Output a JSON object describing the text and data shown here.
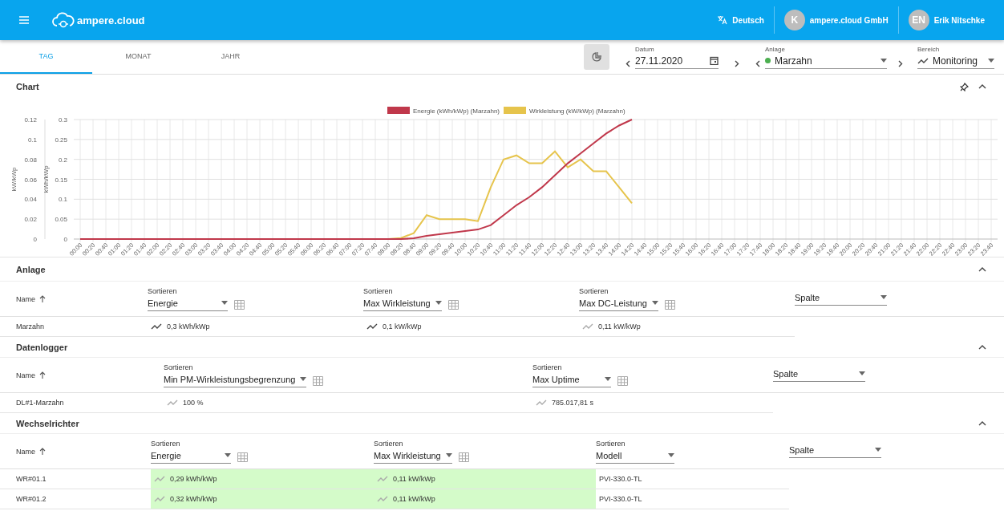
{
  "app_bar": {
    "brand": "ampere.cloud",
    "language": "Deutsch",
    "accounts": [
      {
        "initials": "K",
        "name": "ampere.cloud GmbH"
      },
      {
        "initials": "EN",
        "name": "Erik Nitschke"
      }
    ]
  },
  "tabs": [
    {
      "label": "TAG",
      "selected": true
    },
    {
      "label": "MONAT",
      "selected": false
    },
    {
      "label": "JAHR",
      "selected": false
    }
  ],
  "filters": {
    "date": {
      "label": "Datum",
      "value": "27.11.2020"
    },
    "plant": {
      "label": "Anlage",
      "value": "Marzahn",
      "color": "#4caf50"
    },
    "area": {
      "label": "Bereich",
      "value": "Monitoring"
    }
  },
  "chart": {
    "title": "Chart",
    "chart_data": {
      "type": "line",
      "grid": true,
      "legend": true,
      "ylabel": "kWh/kWp",
      "ylim": [
        0,
        0.3
      ],
      "yticks": [
        0,
        0.05,
        0.1,
        0.15,
        0.2,
        0.25,
        0.3
      ],
      "y2label": "kW/kWp",
      "y2lim": [
        0,
        0.12
      ],
      "y2ticks": [
        0,
        0.02,
        0.04,
        0.06,
        0.08,
        0.1,
        0.12
      ],
      "categories": [
        "00:00",
        "00:20",
        "00:40",
        "01:00",
        "01:20",
        "01:40",
        "02:00",
        "02:20",
        "02:40",
        "03:00",
        "03:20",
        "03:40",
        "04:00",
        "04:20",
        "04:40",
        "05:00",
        "05:20",
        "05:40",
        "06:00",
        "06:20",
        "06:40",
        "07:00",
        "07:20",
        "07:40",
        "08:00",
        "08:20",
        "08:40",
        "09:00",
        "09:20",
        "09:40",
        "10:00",
        "10:20",
        "10:40",
        "11:00",
        "11:20",
        "11:40",
        "12:00",
        "12:20",
        "12:40",
        "13:00",
        "13:20",
        "13:40",
        "14:00",
        "14:20",
        "14:40",
        "15:00",
        "15:20",
        "15:40",
        "16:00",
        "16:20",
        "16:40",
        "17:00",
        "17:20",
        "17:40",
        "18:00",
        "18:20",
        "18:40",
        "19:00",
        "19:20",
        "19:40",
        "20:00",
        "20:20",
        "20:40",
        "21:00",
        "21:20",
        "21:40",
        "22:00",
        "22:20",
        "22:40",
        "23:00",
        "23:20",
        "23:40"
      ],
      "series": [
        {
          "name": "Energie (kWh/kWp) (Marzahn)",
          "color": "#c0384b",
          "axis": "y",
          "values": [
            0,
            0,
            0,
            0,
            0,
            0,
            0,
            0,
            0,
            0,
            0,
            0,
            0,
            0,
            0,
            0,
            0,
            0,
            0,
            0,
            0,
            0,
            0,
            0,
            0,
            0,
            0.002,
            0.008,
            0.012,
            0.016,
            0.02,
            0.024,
            0.035,
            0.06,
            0.085,
            0.105,
            0.13,
            0.16,
            0.19,
            0.215,
            0.24,
            0.265,
            0.285,
            0.3,
            null,
            null,
            null,
            null,
            null,
            null,
            null,
            null,
            null,
            null,
            null,
            null,
            null,
            null,
            null,
            null,
            null,
            null,
            null,
            null,
            null,
            null,
            null,
            null,
            null,
            null,
            null,
            null
          ]
        },
        {
          "name": "Wirkleistung (kW/kWp) (Marzahn)",
          "color": "#e6c44c",
          "axis": "y2",
          "values": [
            null,
            null,
            null,
            null,
            null,
            null,
            null,
            null,
            null,
            null,
            null,
            null,
            null,
            null,
            null,
            null,
            null,
            null,
            null,
            null,
            null,
            null,
            null,
            null,
            0,
            0.001,
            0.006,
            0.024,
            0.02,
            0.02,
            0.02,
            0.018,
            0.052,
            0.08,
            0.084,
            0.076,
            0.076,
            0.088,
            0.072,
            0.08,
            0.068,
            0.068,
            0.052,
            0.036,
            null,
            null,
            null,
            null,
            null,
            null,
            null,
            null,
            null,
            null,
            null,
            null,
            null,
            null,
            null,
            null,
            null,
            null,
            null,
            null,
            null,
            null,
            null,
            null,
            null,
            null,
            null,
            null
          ]
        }
      ]
    }
  },
  "sections": [
    {
      "title": "Anlage",
      "name_header": "Name",
      "columns": [
        {
          "label": "Sortieren",
          "value": "Energie",
          "grid": true
        },
        {
          "label": "Sortieren",
          "value": "Max Wirkleistung",
          "grid": true
        },
        {
          "label": "Sortieren",
          "value": "Max DC-Leistung",
          "grid": true
        },
        {
          "value": "Spalte",
          "grid": false
        }
      ],
      "rows": [
        {
          "name": "Marzahn",
          "cells": [
            {
              "text": "0,3 kWh/kWp",
              "kind": "trend",
              "highlight": false
            },
            {
              "text": "0,1 kW/kWp",
              "kind": "trend",
              "highlight": false
            },
            {
              "text": "0,11 kW/kWp",
              "kind": "muted",
              "highlight": false
            }
          ]
        }
      ]
    },
    {
      "title": "Datenlogger",
      "name_header": "Name",
      "columns": [
        {
          "label": "Sortieren",
          "value": "Min PM-Wirkleistungsbegrenzung",
          "grid": true
        },
        {
          "label": "Sortieren",
          "value": "Max Uptime",
          "grid": true
        },
        {
          "value": "Spalte",
          "grid": false
        }
      ],
      "rows": [
        {
          "name": "DL#1-Marzahn",
          "cells": [
            {
              "text": "100 %",
              "kind": "muted",
              "highlight": false
            },
            {
              "text": "785.017,81 s",
              "kind": "muted",
              "highlight": false
            }
          ]
        }
      ]
    },
    {
      "title": "Wechselrichter",
      "name_header": "Name",
      "columns": [
        {
          "label": "Sortieren",
          "value": "Energie",
          "grid": true
        },
        {
          "label": "Sortieren",
          "value": "Max Wirkleistung",
          "grid": true
        },
        {
          "label": "Sortieren",
          "value": "Modell",
          "grid": false
        },
        {
          "value": "Spalte",
          "grid": false
        }
      ],
      "rows": [
        {
          "name": "WR#01.1",
          "cells": [
            {
              "text": "0,29 kWh/kWp",
              "kind": "muted",
              "highlight": true
            },
            {
              "text": "0,11 kW/kWp",
              "kind": "muted",
              "highlight": true
            },
            {
              "text": "PVI-330.0-TL",
              "kind": "plain",
              "highlight": false
            }
          ]
        },
        {
          "name": "WR#01.2",
          "cells": [
            {
              "text": "0,32 kWh/kWp",
              "kind": "muted",
              "highlight": true
            },
            {
              "text": "0,11 kW/kWp",
              "kind": "muted",
              "highlight": true
            },
            {
              "text": "PVI-330.0-TL",
              "kind": "plain",
              "highlight": false
            }
          ]
        }
      ]
    }
  ]
}
